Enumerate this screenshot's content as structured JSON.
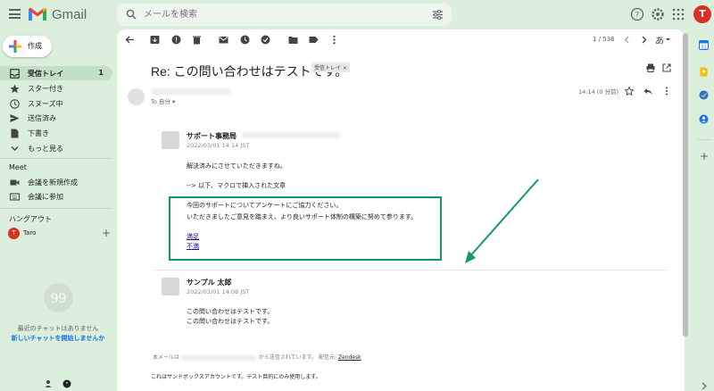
{
  "app": {
    "logo_text": "Gmail"
  },
  "search": {
    "placeholder": "メールを検索"
  },
  "account": {
    "initial": "T"
  },
  "sidebar": {
    "compose_label": "作成",
    "items": [
      {
        "label": "受信トレイ",
        "count": "1"
      },
      {
        "label": "スター付き"
      },
      {
        "label": "スヌーズ中"
      },
      {
        "label": "送信済み"
      },
      {
        "label": "下書き"
      },
      {
        "label": "もっと見る"
      }
    ],
    "meet_title": "Meet",
    "meet_items": [
      {
        "label": "会議を新規作成"
      },
      {
        "label": "会議に参加"
      }
    ],
    "hangouts_title": "ハングアウト",
    "hangout_user": {
      "initial": "T",
      "name": "Taro"
    },
    "empty_chat": "最近のチャットはありません",
    "new_chat": "新しいチャットを開始しませんか"
  },
  "toolbar": {
    "pager": "1 / 536"
  },
  "email": {
    "subject": "Re: この問い合わせはテストです。",
    "label_chip": "受信トレイ ×",
    "to_me": "To 自分 ▾",
    "time": "14:14 (0 分前)",
    "quote1": {
      "sender": "サポート事務局",
      "date": "2022/03/01 14:14 JST",
      "line1": "解決済みにさせていただきますね。",
      "line2": "--> 以下、マクロで挿入された文章",
      "survey1": "今回のサポートについてアンケートにご協力ください。",
      "survey2": "いただきましたご意見を踏まえ、より良いサポート体制の構築に努めて参ります。",
      "link_yes": "満足",
      "link_no": "不満"
    },
    "quote2": {
      "sender": "サンプル 太郎",
      "date": "2022/03/01 14:08 JST",
      "line1": "この問い合わせはテストです。",
      "line2": "この問い合わせはテストです。"
    },
    "footer_prefix": "本メールは",
    "footer_middle": "から送信されています。 配信元:",
    "footer_link": "Zendesk",
    "footer_sandbox": "これはサンドボックスアカウントです。テスト目的にのみ使用します。"
  },
  "colors": {
    "accent_green": "#139a61",
    "background": "#dcefdc",
    "link": "#1a0dab"
  }
}
